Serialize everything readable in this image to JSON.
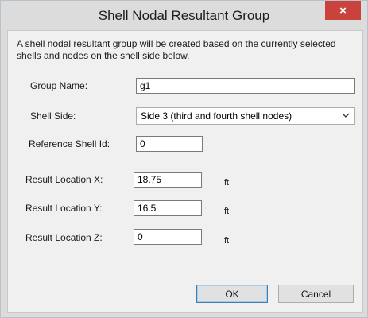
{
  "window": {
    "title": "Shell Nodal Resultant Group",
    "close_glyph": "×"
  },
  "description": "A shell nodal resultant group will be created based on the currently selected shells and nodes on the shell side below.",
  "form": {
    "group_name": {
      "label": "Group Name:",
      "value": "g1"
    },
    "shell_side": {
      "label": "Shell Side:",
      "selected": "Side 3 (third and fourth shell nodes)"
    },
    "reference_shell_id": {
      "label": "Reference Shell Id:",
      "value": "0"
    },
    "result_location_x": {
      "label": "Result Location X:",
      "value": "18.75",
      "unit": "ft"
    },
    "result_location_y": {
      "label": "Result Location Y:",
      "value": "16.5",
      "unit": "ft"
    },
    "result_location_z": {
      "label": "Result Location Z:",
      "value": "0",
      "unit": "ft"
    }
  },
  "buttons": {
    "ok": "OK",
    "cancel": "Cancel"
  },
  "icons": {
    "close": "close-icon",
    "dropdown": "chevron-down-icon"
  },
  "colors": {
    "close_button": "#c9423b",
    "client_background": "#f0f0f0",
    "default_button_border": "#3c7fb1"
  }
}
